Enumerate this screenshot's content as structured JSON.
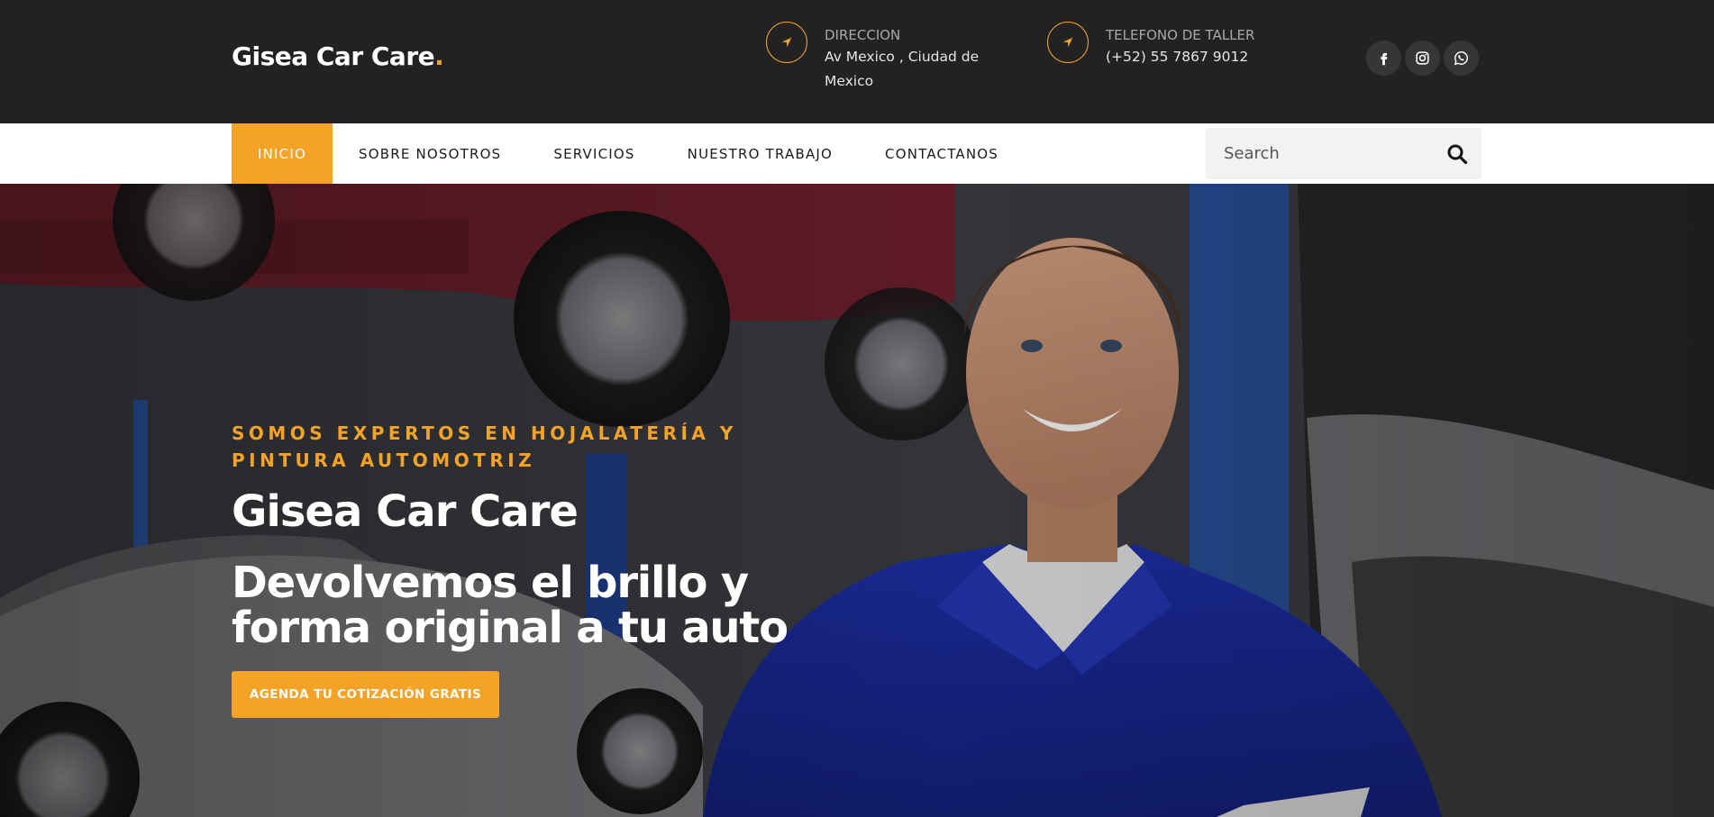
{
  "brand": {
    "name": "Gisea Car Care",
    "dot": ".",
    "accent_color": "#f5a327"
  },
  "topbar": {
    "address": {
      "icon": "location-arrow-icon",
      "label": "DIRECCION",
      "value": "Av Mexico , Ciudad de Mexico"
    },
    "phone": {
      "icon": "location-arrow-icon",
      "label": "TELEFONO DE TALLER",
      "value": "(+52) 55 7867 9012"
    },
    "socials": [
      {
        "name": "facebook-icon"
      },
      {
        "name": "instagram-icon"
      },
      {
        "name": "whatsapp-icon"
      }
    ]
  },
  "nav": {
    "items": [
      {
        "label": "INICIO",
        "active": true
      },
      {
        "label": "SOBRE NOSOTROS",
        "active": false
      },
      {
        "label": "SERVICIOS",
        "active": false
      },
      {
        "label": "NUESTRO TRABAJO",
        "active": false
      },
      {
        "label": "CONTACTANOS",
        "active": false
      }
    ],
    "search": {
      "placeholder": "Search",
      "icon": "search-icon"
    }
  },
  "hero": {
    "kicker": "SOMOS EXPERTOS EN HOJALATERÍA Y PINTURA AUTOMOTRIZ",
    "title": "Gisea Car Care",
    "subtitle": "Devolvemos el brillo y forma original a tu auto",
    "cta": "AGENDA TU COTIZACIÓN GRATIS"
  }
}
